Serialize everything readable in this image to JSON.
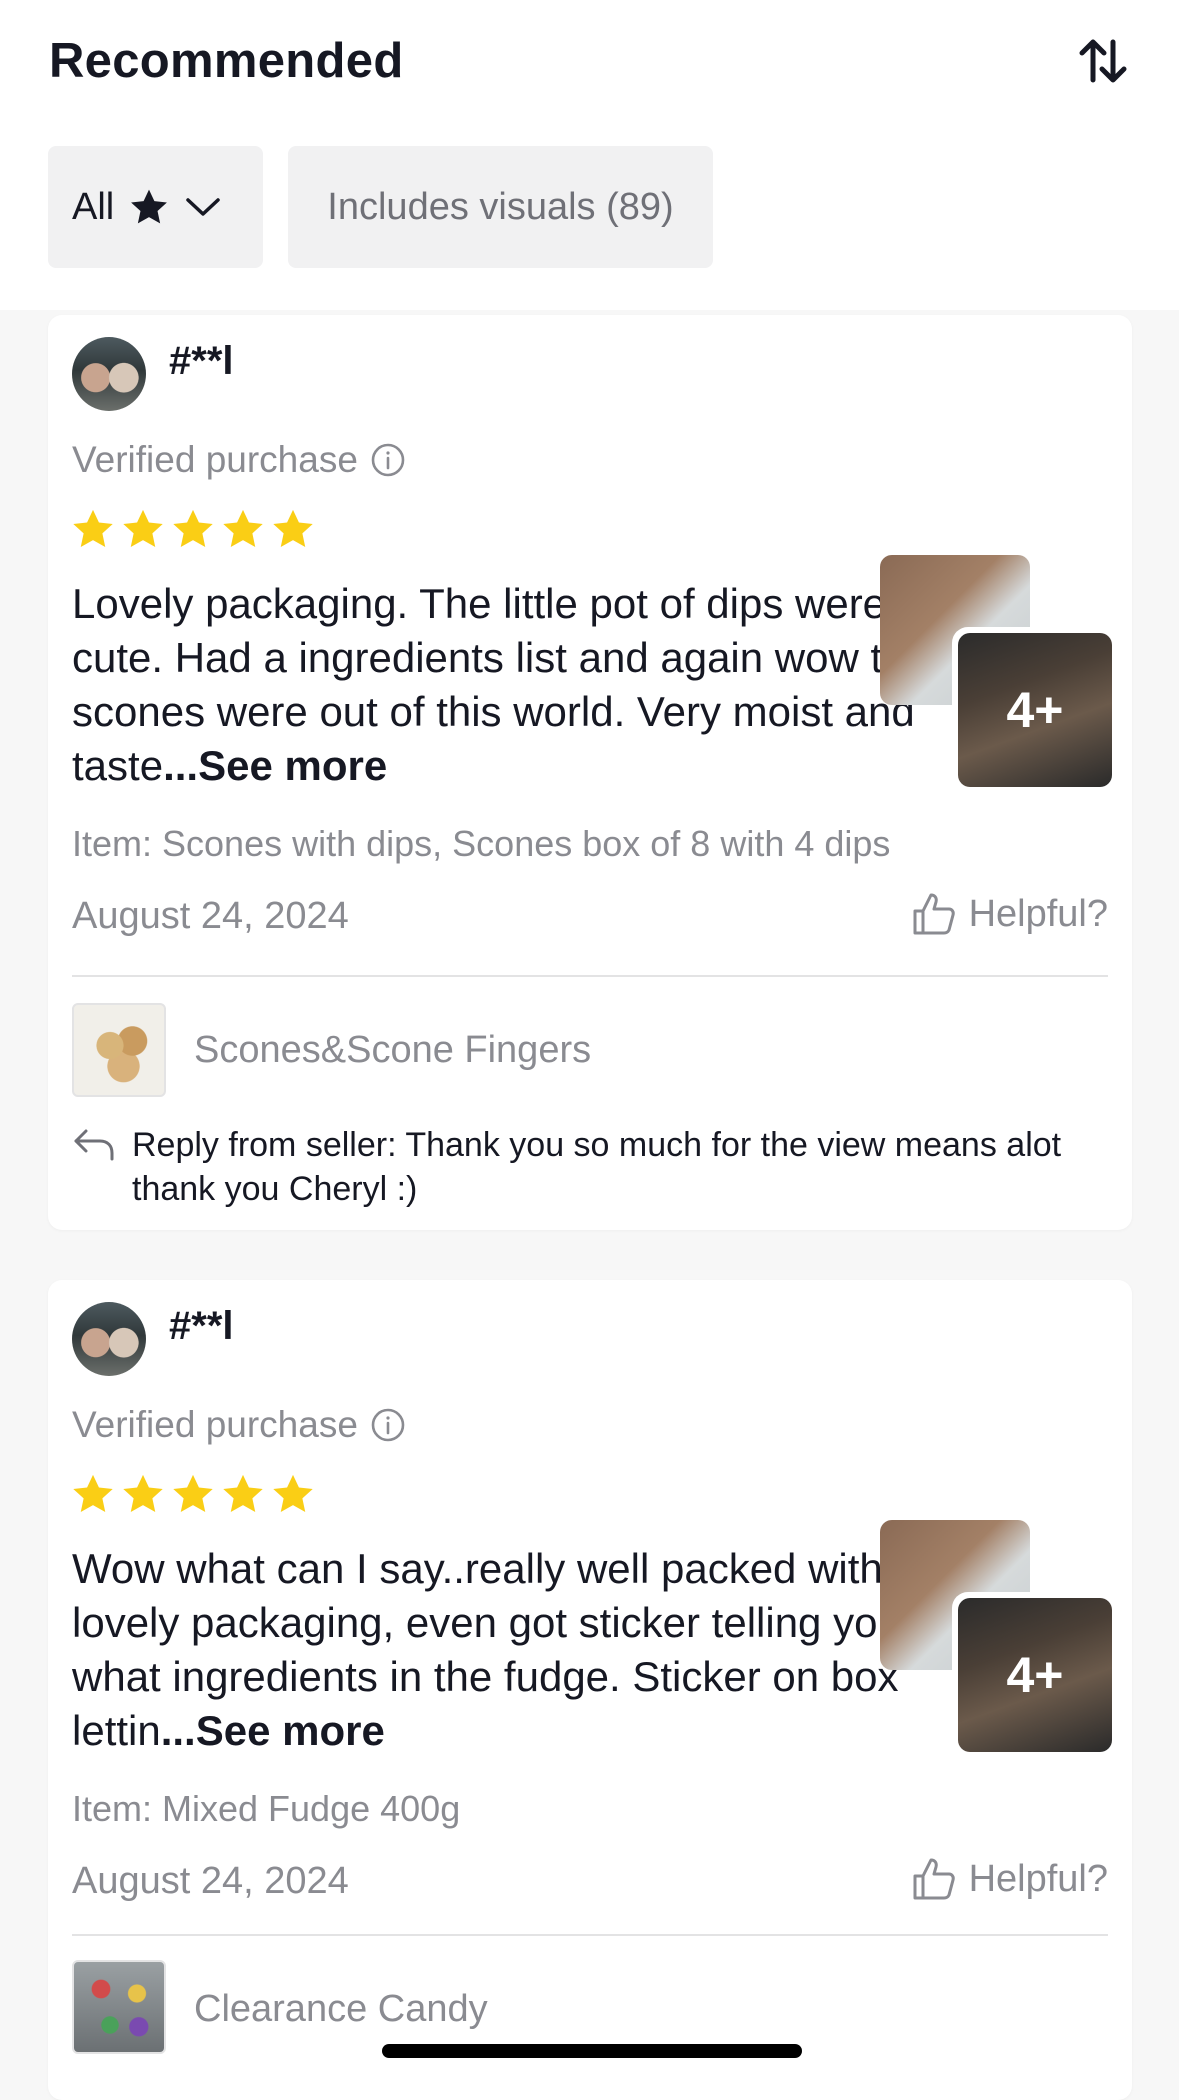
{
  "header": {
    "title": "Recommended",
    "sort_icon": "sort-arrows-icon"
  },
  "filters": {
    "all_label": "All",
    "all_icons": [
      "star-icon",
      "chevron-down-icon"
    ],
    "visuals_label": "Includes visuals (89)"
  },
  "reviews": [
    {
      "username": "#**l",
      "verified_label": "Verified purchase",
      "rating": 5,
      "text": "Lovely packaging. The little pot of dips were cute. Had a ingredients list and again wow the scones were out of this world. Very moist and taste",
      "see_more": "...See more",
      "media_count": "4+",
      "item": "Item: Scones with dips, Scones box of 8 with 4 dips",
      "date": "August 24, 2024",
      "helpful_label": "Helpful?",
      "product_name": "Scones&Scone Fingers",
      "reply": "Reply from seller: Thank you so much for the view means alot thank you Cheryl :)"
    },
    {
      "username": "#**l",
      "verified_label": "Verified purchase",
      "rating": 5,
      "text": "Wow what can I say..really well packed with lovely packaging, even got sticker telling you what ingredients in the fudge. Sticker on box lettin",
      "see_more": "...See more",
      "media_count": "4+",
      "item": "Item: Mixed Fudge 400g",
      "date": "August 24, 2024",
      "helpful_label": "Helpful?",
      "product_name": "Clearance Candy"
    }
  ],
  "colors": {
    "star": "#FACE15",
    "muted_text": "#8A8B91",
    "chip_bg": "#F1F1F2"
  }
}
